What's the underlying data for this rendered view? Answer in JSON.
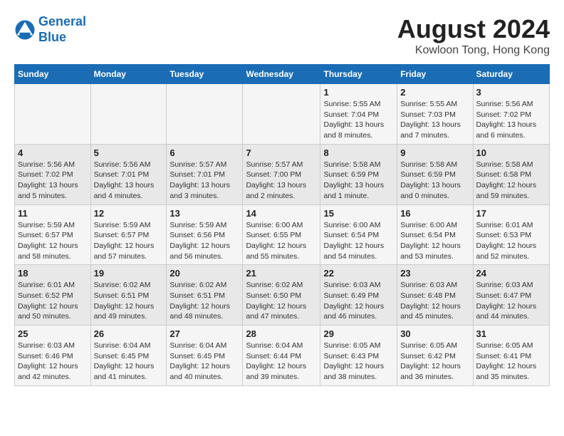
{
  "header": {
    "logo_line1": "General",
    "logo_line2": "Blue",
    "month_title": "August 2024",
    "location": "Kowloon Tong, Hong Kong"
  },
  "days_of_week": [
    "Sunday",
    "Monday",
    "Tuesday",
    "Wednesday",
    "Thursday",
    "Friday",
    "Saturday"
  ],
  "weeks": [
    [
      {
        "day": "",
        "info": ""
      },
      {
        "day": "",
        "info": ""
      },
      {
        "day": "",
        "info": ""
      },
      {
        "day": "",
        "info": ""
      },
      {
        "day": "1",
        "info": "Sunrise: 5:55 AM\nSunset: 7:04 PM\nDaylight: 13 hours\nand 8 minutes."
      },
      {
        "day": "2",
        "info": "Sunrise: 5:55 AM\nSunset: 7:03 PM\nDaylight: 13 hours\nand 7 minutes."
      },
      {
        "day": "3",
        "info": "Sunrise: 5:56 AM\nSunset: 7:02 PM\nDaylight: 13 hours\nand 6 minutes."
      }
    ],
    [
      {
        "day": "4",
        "info": "Sunrise: 5:56 AM\nSunset: 7:02 PM\nDaylight: 13 hours\nand 5 minutes."
      },
      {
        "day": "5",
        "info": "Sunrise: 5:56 AM\nSunset: 7:01 PM\nDaylight: 13 hours\nand 4 minutes."
      },
      {
        "day": "6",
        "info": "Sunrise: 5:57 AM\nSunset: 7:01 PM\nDaylight: 13 hours\nand 3 minutes."
      },
      {
        "day": "7",
        "info": "Sunrise: 5:57 AM\nSunset: 7:00 PM\nDaylight: 13 hours\nand 2 minutes."
      },
      {
        "day": "8",
        "info": "Sunrise: 5:58 AM\nSunset: 6:59 PM\nDaylight: 13 hours\nand 1 minute."
      },
      {
        "day": "9",
        "info": "Sunrise: 5:58 AM\nSunset: 6:59 PM\nDaylight: 13 hours\nand 0 minutes."
      },
      {
        "day": "10",
        "info": "Sunrise: 5:58 AM\nSunset: 6:58 PM\nDaylight: 12 hours\nand 59 minutes."
      }
    ],
    [
      {
        "day": "11",
        "info": "Sunrise: 5:59 AM\nSunset: 6:57 PM\nDaylight: 12 hours\nand 58 minutes."
      },
      {
        "day": "12",
        "info": "Sunrise: 5:59 AM\nSunset: 6:57 PM\nDaylight: 12 hours\nand 57 minutes."
      },
      {
        "day": "13",
        "info": "Sunrise: 5:59 AM\nSunset: 6:56 PM\nDaylight: 12 hours\nand 56 minutes."
      },
      {
        "day": "14",
        "info": "Sunrise: 6:00 AM\nSunset: 6:55 PM\nDaylight: 12 hours\nand 55 minutes."
      },
      {
        "day": "15",
        "info": "Sunrise: 6:00 AM\nSunset: 6:54 PM\nDaylight: 12 hours\nand 54 minutes."
      },
      {
        "day": "16",
        "info": "Sunrise: 6:00 AM\nSunset: 6:54 PM\nDaylight: 12 hours\nand 53 minutes."
      },
      {
        "day": "17",
        "info": "Sunrise: 6:01 AM\nSunset: 6:53 PM\nDaylight: 12 hours\nand 52 minutes."
      }
    ],
    [
      {
        "day": "18",
        "info": "Sunrise: 6:01 AM\nSunset: 6:52 PM\nDaylight: 12 hours\nand 50 minutes."
      },
      {
        "day": "19",
        "info": "Sunrise: 6:02 AM\nSunset: 6:51 PM\nDaylight: 12 hours\nand 49 minutes."
      },
      {
        "day": "20",
        "info": "Sunrise: 6:02 AM\nSunset: 6:51 PM\nDaylight: 12 hours\nand 48 minutes."
      },
      {
        "day": "21",
        "info": "Sunrise: 6:02 AM\nSunset: 6:50 PM\nDaylight: 12 hours\nand 47 minutes."
      },
      {
        "day": "22",
        "info": "Sunrise: 6:03 AM\nSunset: 6:49 PM\nDaylight: 12 hours\nand 46 minutes."
      },
      {
        "day": "23",
        "info": "Sunrise: 6:03 AM\nSunset: 6:48 PM\nDaylight: 12 hours\nand 45 minutes."
      },
      {
        "day": "24",
        "info": "Sunrise: 6:03 AM\nSunset: 6:47 PM\nDaylight: 12 hours\nand 44 minutes."
      }
    ],
    [
      {
        "day": "25",
        "info": "Sunrise: 6:03 AM\nSunset: 6:46 PM\nDaylight: 12 hours\nand 42 minutes."
      },
      {
        "day": "26",
        "info": "Sunrise: 6:04 AM\nSunset: 6:45 PM\nDaylight: 12 hours\nand 41 minutes."
      },
      {
        "day": "27",
        "info": "Sunrise: 6:04 AM\nSunset: 6:45 PM\nDaylight: 12 hours\nand 40 minutes."
      },
      {
        "day": "28",
        "info": "Sunrise: 6:04 AM\nSunset: 6:44 PM\nDaylight: 12 hours\nand 39 minutes."
      },
      {
        "day": "29",
        "info": "Sunrise: 6:05 AM\nSunset: 6:43 PM\nDaylight: 12 hours\nand 38 minutes."
      },
      {
        "day": "30",
        "info": "Sunrise: 6:05 AM\nSunset: 6:42 PM\nDaylight: 12 hours\nand 36 minutes."
      },
      {
        "day": "31",
        "info": "Sunrise: 6:05 AM\nSunset: 6:41 PM\nDaylight: 12 hours\nand 35 minutes."
      }
    ]
  ]
}
